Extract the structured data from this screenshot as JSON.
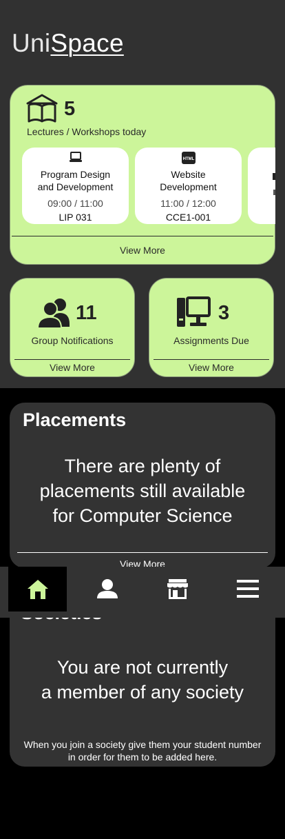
{
  "app": {
    "logo_part1": "Uni",
    "logo_part2": "Space"
  },
  "colors": {
    "accent": "#ccf59a",
    "background": "#313131",
    "card_dark": "#333333",
    "nav_active_bg": "#000000"
  },
  "lectures": {
    "count": "5",
    "label": "Lectures / Workshops today",
    "view_more": "View More",
    "items": [
      {
        "icon": "laptop-icon",
        "title_line1": "Program Design",
        "title_line2": "and Development",
        "time": "09:00 / 11:00",
        "room": "LIP 031"
      },
      {
        "icon": "html-icon",
        "icon_text": "HTML",
        "title_line1": "Website",
        "title_line2": "Development",
        "time": "11:00 / 12:00",
        "room": "CCE1-001"
      }
    ]
  },
  "group_notifications": {
    "count": "11",
    "label": "Group Notifications",
    "view_more": "View More",
    "icon": "users-icon"
  },
  "assignments": {
    "count": "3",
    "label": "Assignments Due",
    "view_more": "View More",
    "icon": "computer-icon"
  },
  "placements": {
    "heading": "Placements",
    "line1": "There are plenty of",
    "line2": "placements still available",
    "line3": "for Computer Science",
    "view_more": "View More"
  },
  "societies": {
    "heading_partial": "Societies",
    "line1": "You are not currently",
    "line2": "a member of any society",
    "note_line1": "When you join a society give them your student number",
    "note_line2": "in order for them to be added here."
  },
  "nav": {
    "items": [
      {
        "icon": "home-icon",
        "active": true
      },
      {
        "icon": "profile-icon",
        "active": false
      },
      {
        "icon": "store-icon",
        "active": false
      },
      {
        "icon": "menu-icon",
        "active": false
      }
    ]
  }
}
